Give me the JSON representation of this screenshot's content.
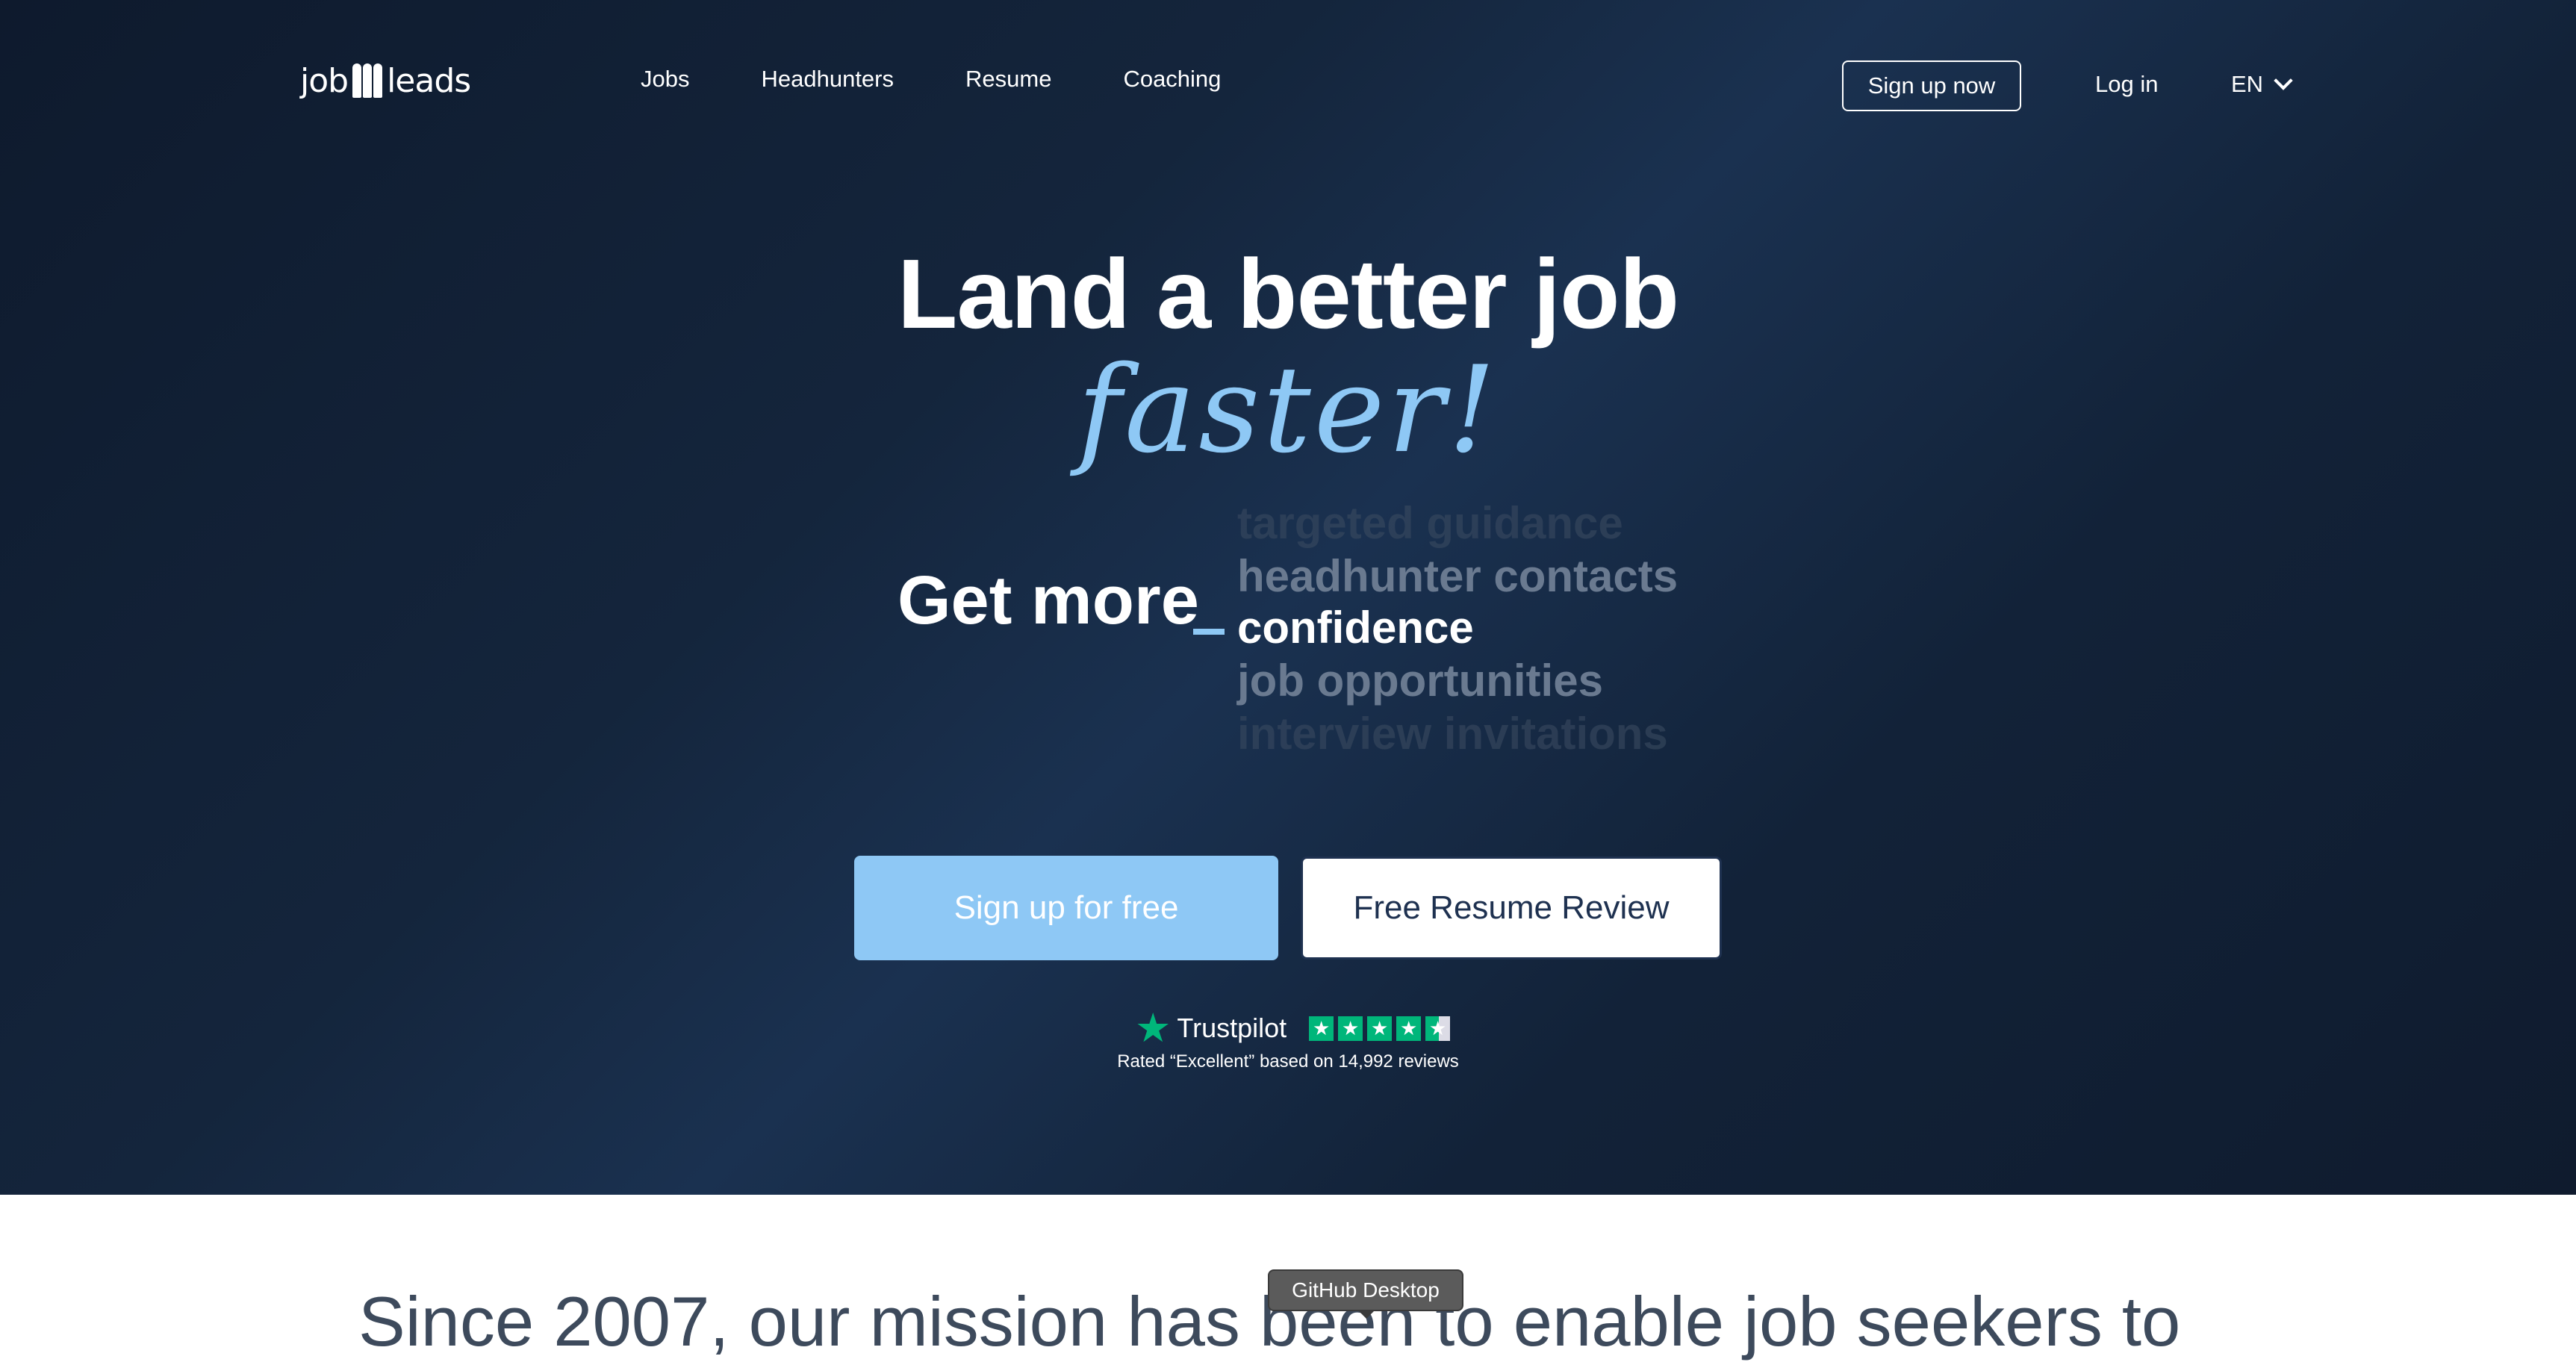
{
  "header": {
    "logo_left": "job",
    "logo_right": "leads",
    "nav": [
      "Jobs",
      "Headhunters",
      "Resume",
      "Coaching"
    ],
    "signup_label": "Sign up now",
    "login_label": "Log in",
    "language": "EN"
  },
  "hero": {
    "headline": "Land a better job",
    "accent": "faster!",
    "get_more": "Get more",
    "rotating": [
      "targeted guidance",
      "headhunter contacts",
      "confidence",
      "job opportunities",
      "interview invitations"
    ],
    "cta_primary": "Sign up for free",
    "cta_secondary": "Free Resume Review"
  },
  "trustpilot": {
    "brand": "Trustpilot",
    "rated_text": "Rated “Excellent” based on 14,992 reviews",
    "rating_stars": 4.5
  },
  "mission": {
    "text": "Since 2007, our mission has been to enable job seekers to"
  },
  "tooltip": {
    "text": "GitHub Desktop"
  },
  "colors": {
    "accent": "#8ec8f5",
    "hero_bg": "#14253c",
    "trustpilot_green": "#00b67a"
  }
}
